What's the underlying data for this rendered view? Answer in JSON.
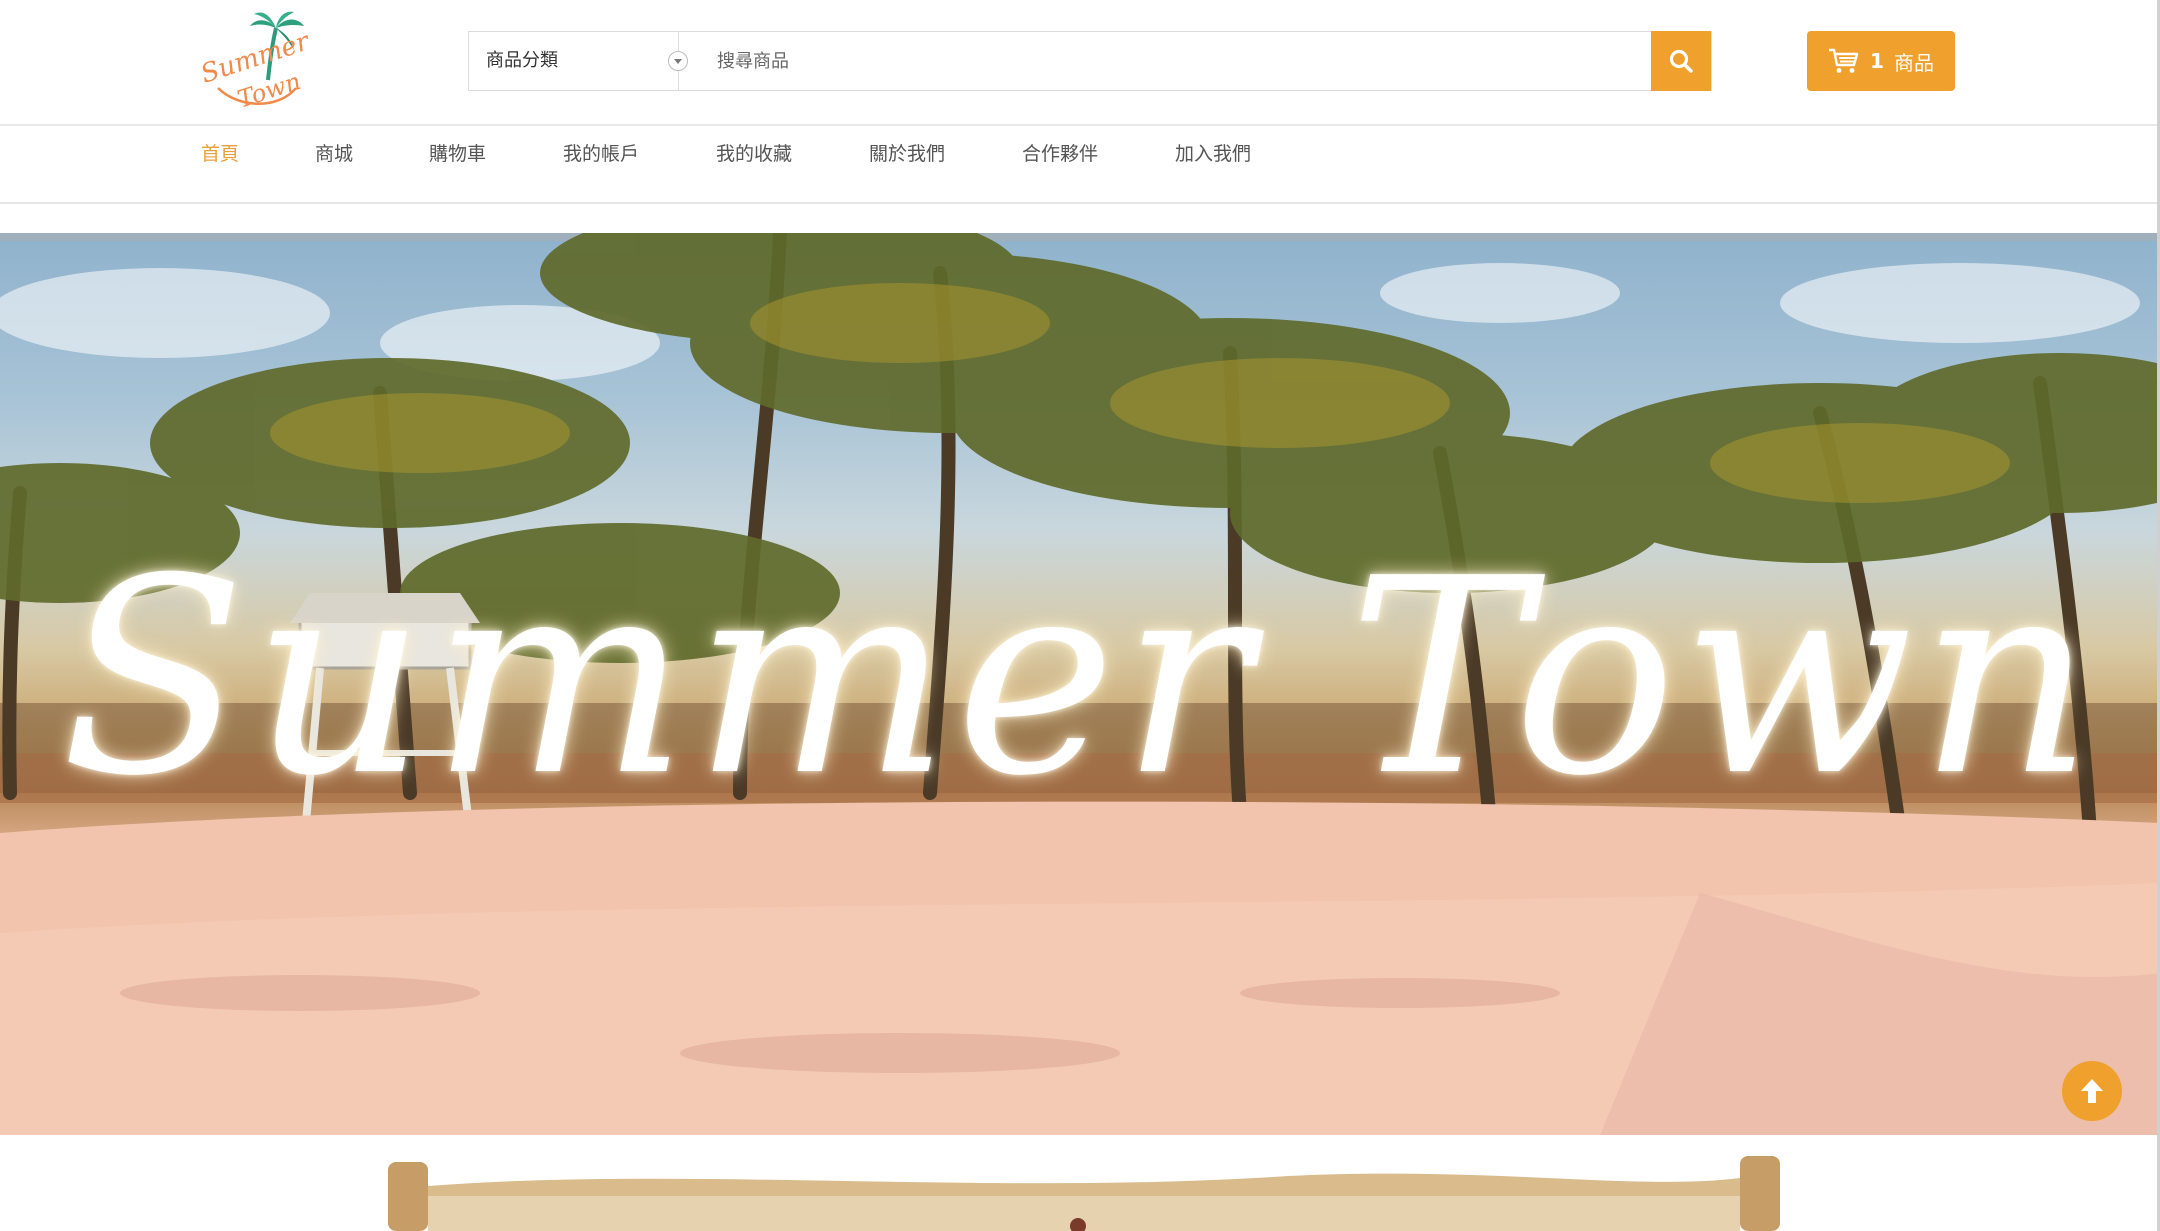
{
  "brand": {
    "logo_text_line1": "Summer",
    "logo_text_line2": "Town",
    "accent_color": "#f0a12d"
  },
  "search": {
    "category_label": "商品分類",
    "placeholder": "搜尋商品",
    "button_icon": "search-icon"
  },
  "cart": {
    "count": "1",
    "label": "商品",
    "icon": "cart-icon"
  },
  "nav": {
    "items": [
      {
        "label": "首頁",
        "active": true
      },
      {
        "label": "商城"
      },
      {
        "label": "購物車"
      },
      {
        "label": "我的帳戶"
      },
      {
        "label": "我的收藏"
      },
      {
        "label": "關於我們"
      },
      {
        "label": "合作夥伴"
      },
      {
        "label": "加入我們"
      }
    ]
  },
  "hero": {
    "title": "Summer Town"
  },
  "scroll_top": {
    "icon": "arrow-up-icon"
  }
}
